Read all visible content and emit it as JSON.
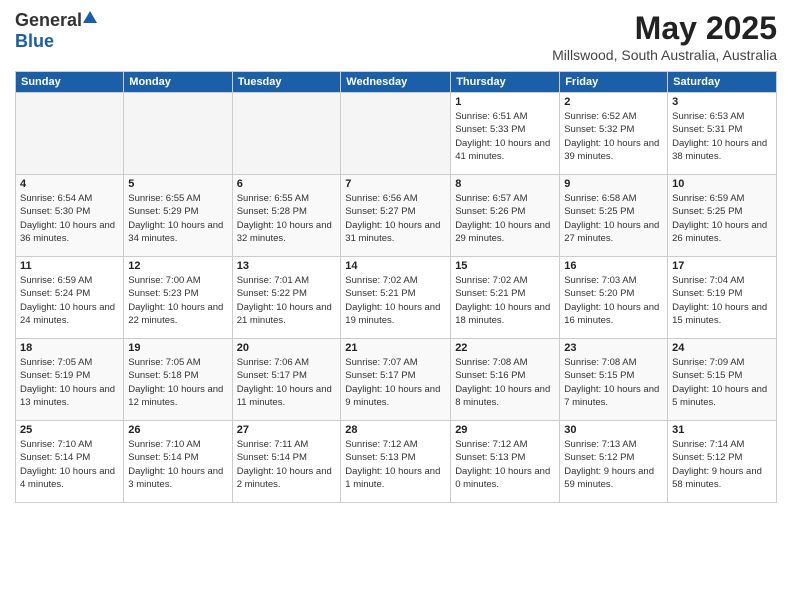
{
  "logo": {
    "general": "General",
    "blue": "Blue"
  },
  "title": "May 2025",
  "location": "Millswood, South Australia, Australia",
  "days_of_week": [
    "Sunday",
    "Monday",
    "Tuesday",
    "Wednesday",
    "Thursday",
    "Friday",
    "Saturday"
  ],
  "weeks": [
    [
      {
        "day": "",
        "sunrise": "",
        "sunset": "",
        "daylight": "",
        "empty": true
      },
      {
        "day": "",
        "sunrise": "",
        "sunset": "",
        "daylight": "",
        "empty": true
      },
      {
        "day": "",
        "sunrise": "",
        "sunset": "",
        "daylight": "",
        "empty": true
      },
      {
        "day": "",
        "sunrise": "",
        "sunset": "",
        "daylight": "",
        "empty": true
      },
      {
        "day": "1",
        "sunrise": "Sunrise: 6:51 AM",
        "sunset": "Sunset: 5:33 PM",
        "daylight": "Daylight: 10 hours and 41 minutes.",
        "empty": false
      },
      {
        "day": "2",
        "sunrise": "Sunrise: 6:52 AM",
        "sunset": "Sunset: 5:32 PM",
        "daylight": "Daylight: 10 hours and 39 minutes.",
        "empty": false
      },
      {
        "day": "3",
        "sunrise": "Sunrise: 6:53 AM",
        "sunset": "Sunset: 5:31 PM",
        "daylight": "Daylight: 10 hours and 38 minutes.",
        "empty": false
      }
    ],
    [
      {
        "day": "4",
        "sunrise": "Sunrise: 6:54 AM",
        "sunset": "Sunset: 5:30 PM",
        "daylight": "Daylight: 10 hours and 36 minutes.",
        "empty": false
      },
      {
        "day": "5",
        "sunrise": "Sunrise: 6:55 AM",
        "sunset": "Sunset: 5:29 PM",
        "daylight": "Daylight: 10 hours and 34 minutes.",
        "empty": false
      },
      {
        "day": "6",
        "sunrise": "Sunrise: 6:55 AM",
        "sunset": "Sunset: 5:28 PM",
        "daylight": "Daylight: 10 hours and 32 minutes.",
        "empty": false
      },
      {
        "day": "7",
        "sunrise": "Sunrise: 6:56 AM",
        "sunset": "Sunset: 5:27 PM",
        "daylight": "Daylight: 10 hours and 31 minutes.",
        "empty": false
      },
      {
        "day": "8",
        "sunrise": "Sunrise: 6:57 AM",
        "sunset": "Sunset: 5:26 PM",
        "daylight": "Daylight: 10 hours and 29 minutes.",
        "empty": false
      },
      {
        "day": "9",
        "sunrise": "Sunrise: 6:58 AM",
        "sunset": "Sunset: 5:25 PM",
        "daylight": "Daylight: 10 hours and 27 minutes.",
        "empty": false
      },
      {
        "day": "10",
        "sunrise": "Sunrise: 6:59 AM",
        "sunset": "Sunset: 5:25 PM",
        "daylight": "Daylight: 10 hours and 26 minutes.",
        "empty": false
      }
    ],
    [
      {
        "day": "11",
        "sunrise": "Sunrise: 6:59 AM",
        "sunset": "Sunset: 5:24 PM",
        "daylight": "Daylight: 10 hours and 24 minutes.",
        "empty": false
      },
      {
        "day": "12",
        "sunrise": "Sunrise: 7:00 AM",
        "sunset": "Sunset: 5:23 PM",
        "daylight": "Daylight: 10 hours and 22 minutes.",
        "empty": false
      },
      {
        "day": "13",
        "sunrise": "Sunrise: 7:01 AM",
        "sunset": "Sunset: 5:22 PM",
        "daylight": "Daylight: 10 hours and 21 minutes.",
        "empty": false
      },
      {
        "day": "14",
        "sunrise": "Sunrise: 7:02 AM",
        "sunset": "Sunset: 5:21 PM",
        "daylight": "Daylight: 10 hours and 19 minutes.",
        "empty": false
      },
      {
        "day": "15",
        "sunrise": "Sunrise: 7:02 AM",
        "sunset": "Sunset: 5:21 PM",
        "daylight": "Daylight: 10 hours and 18 minutes.",
        "empty": false
      },
      {
        "day": "16",
        "sunrise": "Sunrise: 7:03 AM",
        "sunset": "Sunset: 5:20 PM",
        "daylight": "Daylight: 10 hours and 16 minutes.",
        "empty": false
      },
      {
        "day": "17",
        "sunrise": "Sunrise: 7:04 AM",
        "sunset": "Sunset: 5:19 PM",
        "daylight": "Daylight: 10 hours and 15 minutes.",
        "empty": false
      }
    ],
    [
      {
        "day": "18",
        "sunrise": "Sunrise: 7:05 AM",
        "sunset": "Sunset: 5:19 PM",
        "daylight": "Daylight: 10 hours and 13 minutes.",
        "empty": false
      },
      {
        "day": "19",
        "sunrise": "Sunrise: 7:05 AM",
        "sunset": "Sunset: 5:18 PM",
        "daylight": "Daylight: 10 hours and 12 minutes.",
        "empty": false
      },
      {
        "day": "20",
        "sunrise": "Sunrise: 7:06 AM",
        "sunset": "Sunset: 5:17 PM",
        "daylight": "Daylight: 10 hours and 11 minutes.",
        "empty": false
      },
      {
        "day": "21",
        "sunrise": "Sunrise: 7:07 AM",
        "sunset": "Sunset: 5:17 PM",
        "daylight": "Daylight: 10 hours and 9 minutes.",
        "empty": false
      },
      {
        "day": "22",
        "sunrise": "Sunrise: 7:08 AM",
        "sunset": "Sunset: 5:16 PM",
        "daylight": "Daylight: 10 hours and 8 minutes.",
        "empty": false
      },
      {
        "day": "23",
        "sunrise": "Sunrise: 7:08 AM",
        "sunset": "Sunset: 5:15 PM",
        "daylight": "Daylight: 10 hours and 7 minutes.",
        "empty": false
      },
      {
        "day": "24",
        "sunrise": "Sunrise: 7:09 AM",
        "sunset": "Sunset: 5:15 PM",
        "daylight": "Daylight: 10 hours and 5 minutes.",
        "empty": false
      }
    ],
    [
      {
        "day": "25",
        "sunrise": "Sunrise: 7:10 AM",
        "sunset": "Sunset: 5:14 PM",
        "daylight": "Daylight: 10 hours and 4 minutes.",
        "empty": false
      },
      {
        "day": "26",
        "sunrise": "Sunrise: 7:10 AM",
        "sunset": "Sunset: 5:14 PM",
        "daylight": "Daylight: 10 hours and 3 minutes.",
        "empty": false
      },
      {
        "day": "27",
        "sunrise": "Sunrise: 7:11 AM",
        "sunset": "Sunset: 5:14 PM",
        "daylight": "Daylight: 10 hours and 2 minutes.",
        "empty": false
      },
      {
        "day": "28",
        "sunrise": "Sunrise: 7:12 AM",
        "sunset": "Sunset: 5:13 PM",
        "daylight": "Daylight: 10 hours and 1 minute.",
        "empty": false
      },
      {
        "day": "29",
        "sunrise": "Sunrise: 7:12 AM",
        "sunset": "Sunset: 5:13 PM",
        "daylight": "Daylight: 10 hours and 0 minutes.",
        "empty": false
      },
      {
        "day": "30",
        "sunrise": "Sunrise: 7:13 AM",
        "sunset": "Sunset: 5:12 PM",
        "daylight": "Daylight: 9 hours and 59 minutes.",
        "empty": false
      },
      {
        "day": "31",
        "sunrise": "Sunrise: 7:14 AM",
        "sunset": "Sunset: 5:12 PM",
        "daylight": "Daylight: 9 hours and 58 minutes.",
        "empty": false
      }
    ]
  ]
}
